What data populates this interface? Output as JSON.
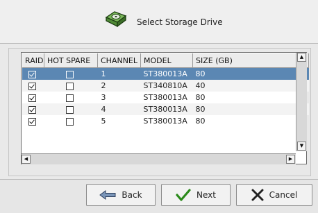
{
  "dialog": {
    "title": "Select Storage Drive",
    "icon": "hard-drive-icon"
  },
  "table": {
    "columns": [
      "RAID",
      "HOT SPARE",
      "CHANNEL",
      "MODEL",
      "SIZE (GB)"
    ],
    "rows": [
      {
        "raid": true,
        "hot_spare": false,
        "channel": "1",
        "model": "ST380013A",
        "size": "80",
        "selected": true
      },
      {
        "raid": true,
        "hot_spare": false,
        "channel": "2",
        "model": "ST340810A",
        "size": "40",
        "selected": false
      },
      {
        "raid": true,
        "hot_spare": false,
        "channel": "3",
        "model": "ST380013A",
        "size": "80",
        "selected": false
      },
      {
        "raid": true,
        "hot_spare": false,
        "channel": "4",
        "model": "ST380013A",
        "size": "80",
        "selected": false
      },
      {
        "raid": true,
        "hot_spare": false,
        "channel": "5",
        "model": "ST380013A",
        "size": "80",
        "selected": false
      }
    ]
  },
  "buttons": {
    "back": "Back",
    "next": "Next",
    "cancel": "Cancel"
  },
  "colors": {
    "selection": "#5b87b3",
    "next_check": "#2a8a1a",
    "cancel_x": "#222222"
  }
}
